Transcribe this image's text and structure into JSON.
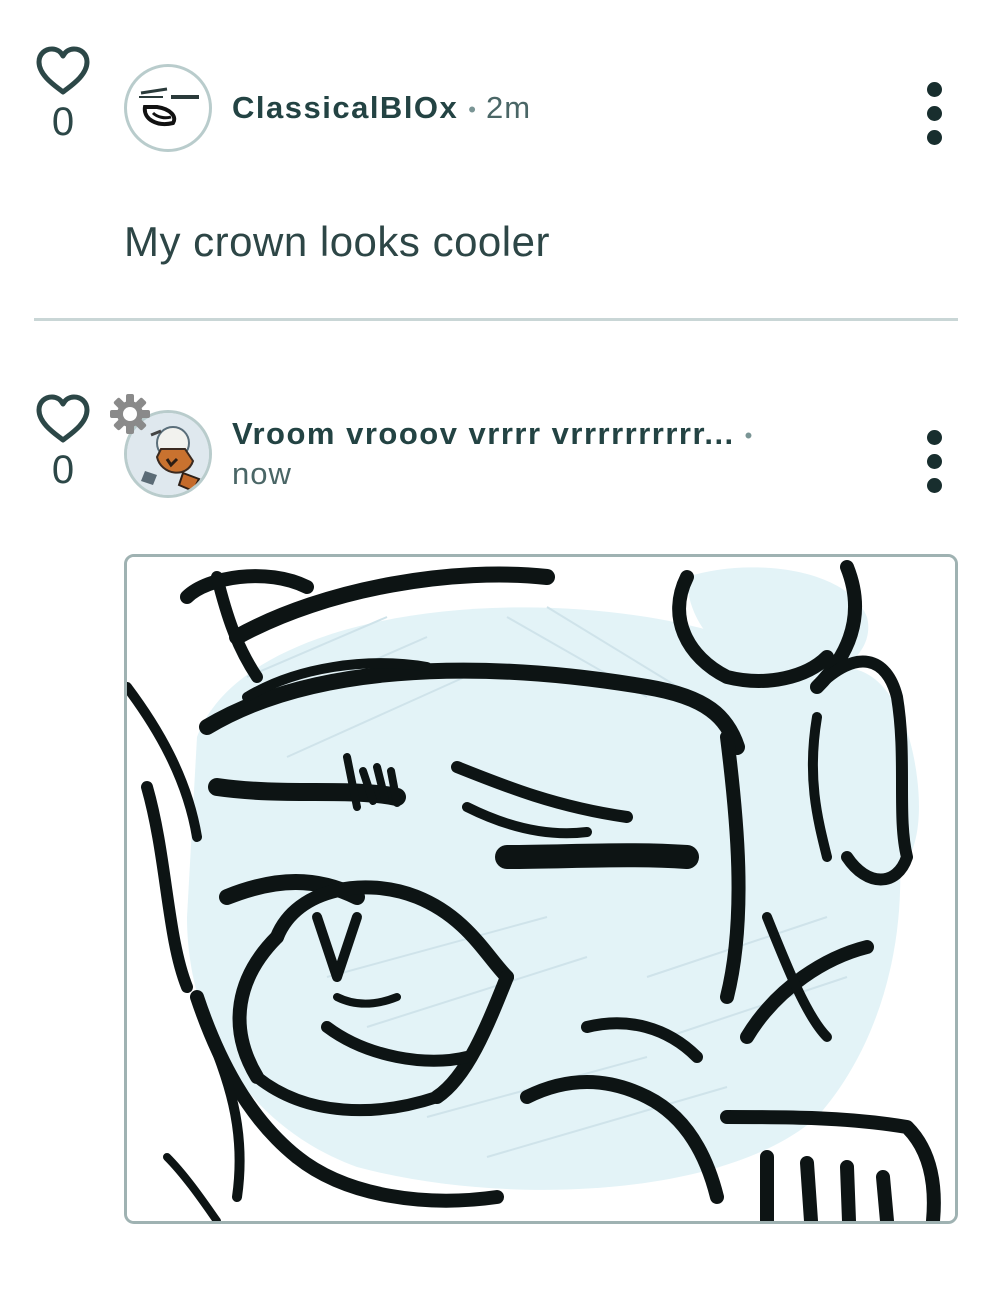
{
  "comments": [
    {
      "likes": "0",
      "username": "ClassicalBlOx",
      "separator": "•",
      "time": "2m",
      "text": "My crown looks cooler"
    },
    {
      "likes": "0",
      "username": "Vroom vrooov vrrrr vrrrrrrrrrr...",
      "separator": "•",
      "time": "now"
    }
  ],
  "colors": {
    "text_primary": "#234343",
    "divider": "#c9d6d6",
    "sketch_background": "#e3f3f7",
    "ink": "#0d1414"
  },
  "icons": {
    "like": "heart-outline-icon",
    "more": "more-vertical-icon",
    "badge": "gear-badge-icon"
  }
}
